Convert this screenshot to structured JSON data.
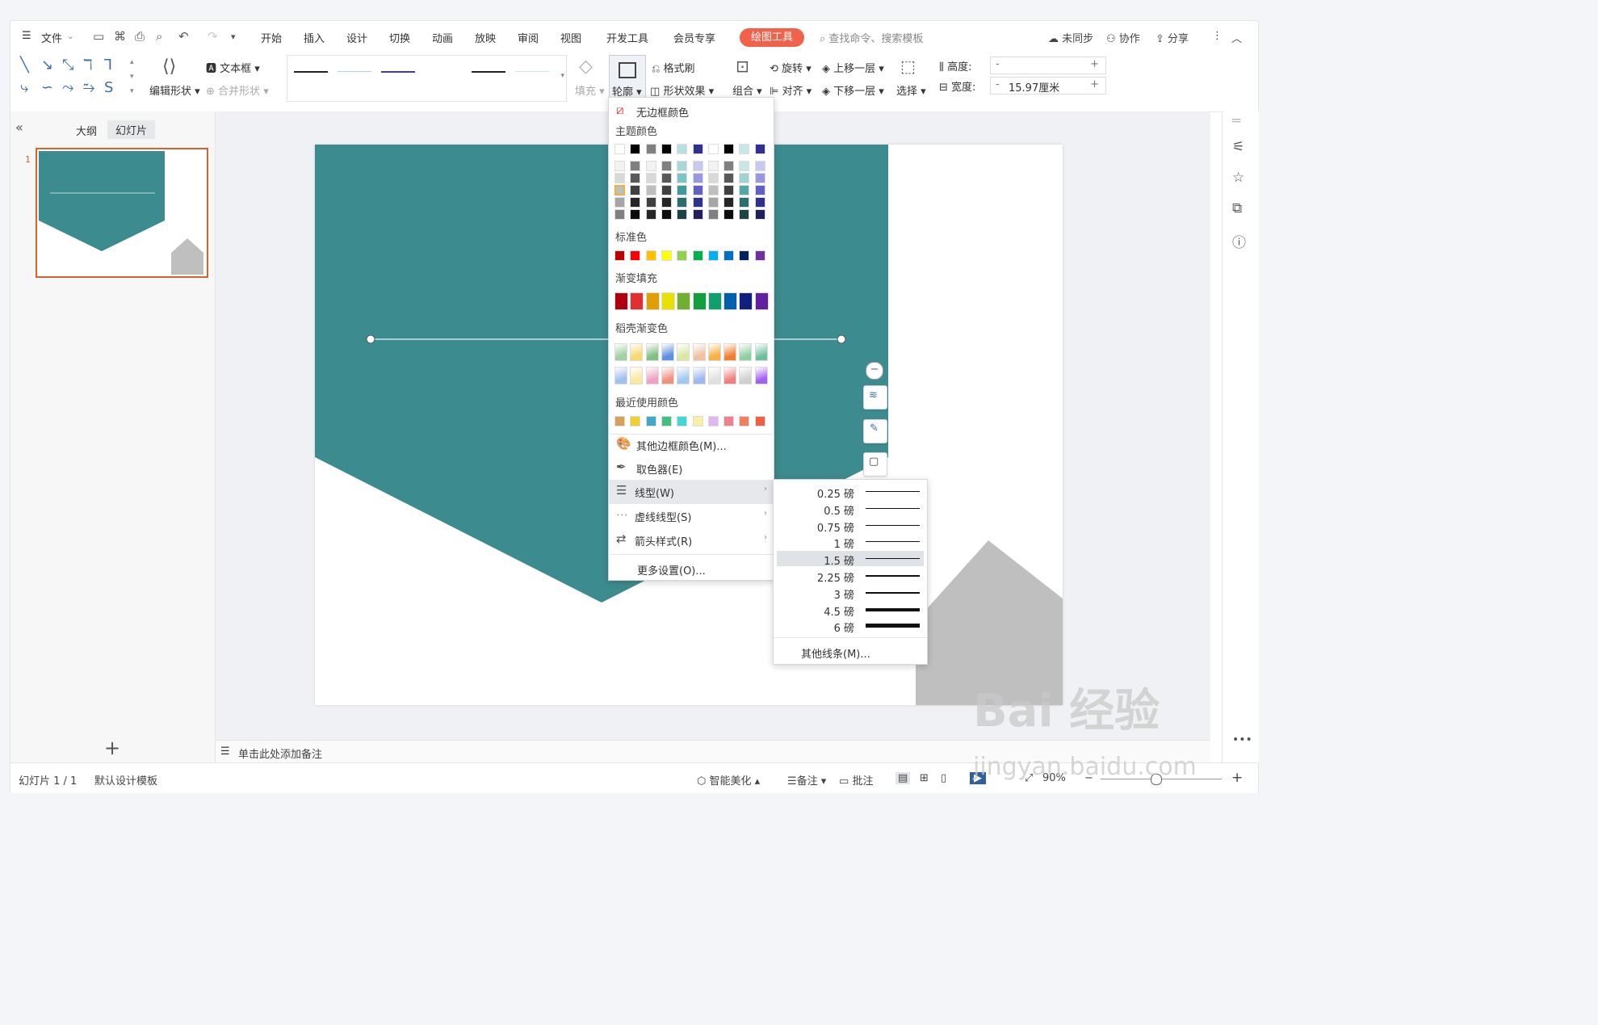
{
  "menu": {
    "file": "文件",
    "tabs": [
      "开始",
      "插入",
      "设计",
      "切换",
      "动画",
      "放映",
      "审阅",
      "视图",
      "开发工具",
      "会员专享"
    ],
    "active_tab": "绘图工具",
    "search_placeholder": "查找命令、搜索模板",
    "sync": "未同步",
    "collab": "协作",
    "share": "分享"
  },
  "ribbon": {
    "edit_shape": "编辑形状",
    "text_box": "文本框",
    "merge_shape": "合并形状",
    "fill": "填充",
    "outline": "轮廓",
    "format_painter": "格式刷",
    "shape_effects": "形状效果",
    "rotate": "旋转",
    "combine": "组合",
    "align": "对齐",
    "bring_forward": "上移一层",
    "send_backward": "下移一层",
    "select": "选择",
    "height_label": "高度:",
    "width_label": "宽度:",
    "height_value": "",
    "width_value": "15.97厘米",
    "minus": "-",
    "plus": "+"
  },
  "panel": {
    "outline_tab": "大纲",
    "slides_tab": "幻灯片",
    "slide_number": "1",
    "add": "+"
  },
  "notes_placeholder": "单击此处添加备注",
  "status": {
    "slide_count": "幻灯片 1 / 1",
    "template": "默认设计模板",
    "beautify": "智能美化",
    "notes": "备注",
    "comments": "批注",
    "zoom": "90%",
    "zoom_minus": "−",
    "zoom_plus": "+"
  },
  "outline_menu": {
    "no_border": "无边框颜色",
    "theme_colors_title": "主题颜色",
    "standard_colors_title": "标准色",
    "gradient_fill_title": "渐变填充",
    "daoke_gradient_title": "稻壳渐变色",
    "recent_colors_title": "最近使用颜色",
    "more_colors": "其他边框颜色(M)...",
    "eyedropper": "取色器(E)",
    "line_type": "线型(W)",
    "dash_type": "虚线线型(S)",
    "arrow_style": "箭头样式(R)",
    "more_settings": "更多设置(O)...",
    "theme_top": [
      "#ffffff",
      "#000000",
      "#808080",
      "#000000",
      "#b8e0e0",
      "#303090",
      "#ffffff",
      "#000000",
      "#c8e8e8",
      "#303090"
    ],
    "standard": [
      "#c00000",
      "#ff0000",
      "#ffc000",
      "#ffff00",
      "#92d050",
      "#00b050",
      "#00b0f0",
      "#0070c0",
      "#002060",
      "#7030a0"
    ],
    "gradient": [
      "#b00010",
      "#e03030",
      "#e0a000",
      "#e8e000",
      "#70b030",
      "#10a040",
      "#10a070",
      "#0060b0",
      "#102080",
      "#6020a0"
    ],
    "recent": [
      "#d9a05a",
      "#f0d030",
      "#40a8c8",
      "#40c080",
      "#40d8d0",
      "#f8f0a0",
      "#e0b8f0",
      "#f08090",
      "#f08060",
      "#f06040"
    ]
  },
  "line_weights": [
    {
      "label": "0.25 磅",
      "weight": 0.25
    },
    {
      "label": "0.5 磅",
      "weight": 0.5
    },
    {
      "label": "0.75 磅",
      "weight": 0.75
    },
    {
      "label": "1 磅",
      "weight": 1
    },
    {
      "label": "1.5 磅",
      "weight": 1.5
    },
    {
      "label": "2.25 磅",
      "weight": 2.25
    },
    {
      "label": "3 磅",
      "weight": 3
    },
    {
      "label": "4.5 磅",
      "weight": 4.5
    },
    {
      "label": "6 磅",
      "weight": 6
    }
  ],
  "line_weight_selected": "1.5 磅",
  "more_lines": "其他线条(M)...",
  "watermark": {
    "main": "Bai 经验",
    "sub": "jingyan.baidu.com"
  },
  "colors": {
    "teal": "#3c8b8e",
    "gray_shape": "#bfbfbf",
    "accent": "#f2624b"
  }
}
